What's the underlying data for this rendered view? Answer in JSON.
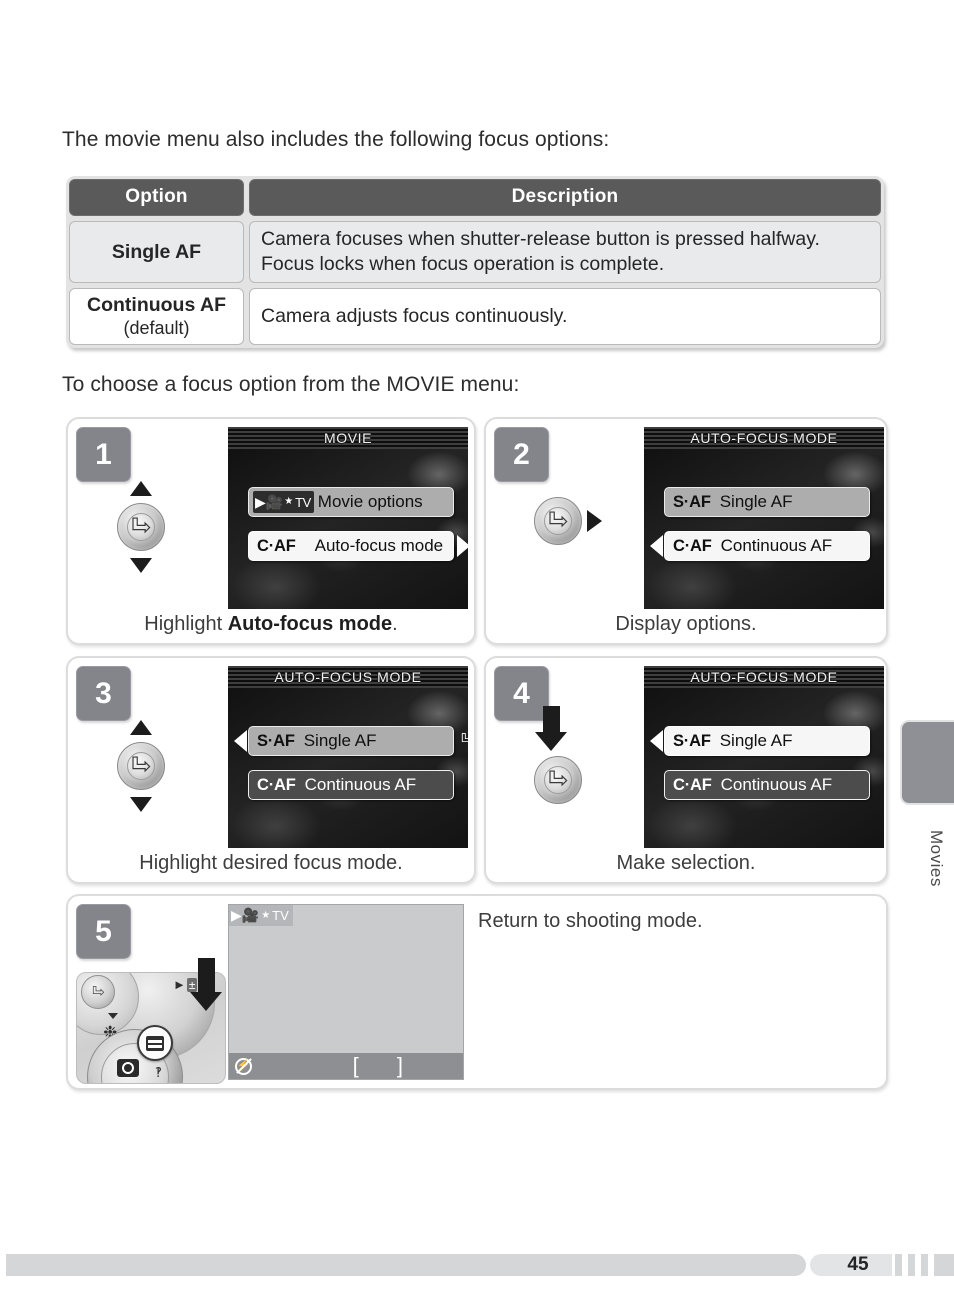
{
  "intro_text": "The movie menu also includes the following focus options:",
  "howto_text": "To choose a focus option from the MOVIE menu:",
  "table": {
    "headers": {
      "option": "Option",
      "description": "Description"
    },
    "rows": [
      {
        "option": "Single AF",
        "option_sub": "",
        "description": "Camera focuses when shutter-release button is pressed halfway. Focus locks when focus operation is complete."
      },
      {
        "option": "Continuous AF",
        "option_sub": "(default)",
        "description": "Camera adjusts focus continuously."
      }
    ]
  },
  "steps": {
    "s1": {
      "number": "1",
      "screen_title": "MOVIE",
      "item1_tag_cam": "▶🎥",
      "item1_tag_star": "★",
      "item1_tag_tv": "TV",
      "item1_label": "Movie options",
      "item2_tag": "C·AF",
      "item2_label": "Auto-focus mode",
      "caption_prefix": "Highlight ",
      "caption_bold": "Auto-focus mode",
      "caption_suffix": "."
    },
    "s2": {
      "number": "2",
      "screen_title": "AUTO-FOCUS MODE",
      "item1_tag": "S·AF",
      "item1_label": "Single AF",
      "item2_tag": "C·AF",
      "item2_label": "Continuous AF",
      "caption": "Display options."
    },
    "s3": {
      "number": "3",
      "screen_title": "AUTO-FOCUS MODE",
      "item1_tag": "S·AF",
      "item1_label": "Single AF",
      "item2_tag": "C·AF",
      "item2_label": "Continuous AF",
      "caption": "Highlight desired focus mode."
    },
    "s4": {
      "number": "4",
      "screen_title": "AUTO-FOCUS MODE",
      "item1_tag": "S·AF",
      "item1_label": "Single AF",
      "item2_tag": "C·AF",
      "item2_label": "Continuous AF",
      "caption": "Make selection."
    },
    "s5": {
      "number": "5",
      "lcd_tag_cam": "▶🎥",
      "lcd_tag_star": "★",
      "lcd_tag_tv": "TV",
      "lcd_brackets": "[ ]",
      "note": "Return to shooting mode."
    }
  },
  "chapter": {
    "label": "Movies"
  },
  "footer": {
    "page_number": "45"
  },
  "colors": {
    "table_header_bg": "#5a5a5a",
    "step_badge_bg": "#84848b",
    "chapter_tab_bg": "#8e9096",
    "footer_bar_bg": "#d4d6d8",
    "row_shaded_bg": "#e9eaec"
  }
}
